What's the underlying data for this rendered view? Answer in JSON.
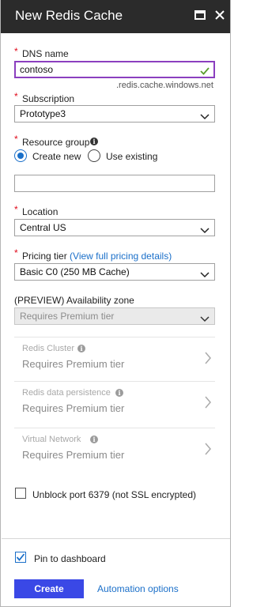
{
  "header": {
    "title": "New Redis Cache",
    "maximize_icon": "maximize-icon",
    "close_icon": "close-icon"
  },
  "dns": {
    "label": "DNS name",
    "value": "contoso",
    "suffix": ".redis.cache.windows.net",
    "valid_icon": "checkmark-icon"
  },
  "subscription": {
    "label": "Subscription",
    "value": "Prototype3"
  },
  "resource_group": {
    "label": "Resource group",
    "options": [
      "Create new",
      "Use existing"
    ],
    "selected": "Create new",
    "value": ""
  },
  "location": {
    "label": "Location",
    "value": "Central US"
  },
  "pricing": {
    "label": "Pricing tier",
    "link_text": "(View full pricing details)",
    "value": "Basic C0 (250 MB Cache)"
  },
  "availability_zone": {
    "label": "(PREVIEW) Availability zone",
    "value": "Requires Premium tier"
  },
  "blades": [
    {
      "label": "Redis Cluster",
      "value": "Requires Premium tier"
    },
    {
      "label": "Redis data persistence",
      "value": "Requires Premium tier"
    },
    {
      "label": "Virtual Network",
      "value": "Requires Premium tier"
    }
  ],
  "unblock_port": {
    "label": "Unblock port 6379 (not SSL encrypted)",
    "checked": false
  },
  "footer": {
    "pin_label": "Pin to dashboard",
    "pin_checked": true,
    "create_label": "Create",
    "automation_label": "Automation options"
  },
  "colors": {
    "header_bg": "#2b2b2b",
    "accent": "#3a48e6",
    "link": "#1a6fc9",
    "required": "#e00b1c",
    "focus_border": "#8b3fbf",
    "valid": "#5a9e2f"
  }
}
